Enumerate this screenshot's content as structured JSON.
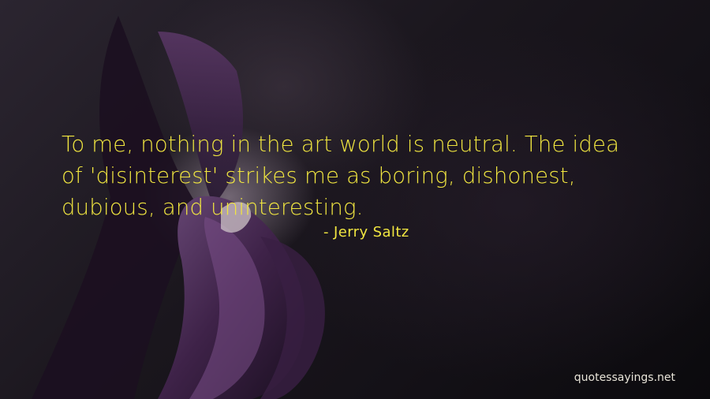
{
  "quote": {
    "text": "To me, nothing in the art world is neutral. The idea of 'disinterest' strikes me as boring, dishonest, dubious, and uninteresting.",
    "author": "- Jerry Saltz"
  },
  "watermark": {
    "text": "quotessayings.net"
  },
  "colors": {
    "quote_text": "#f1e640",
    "watermark_text": "#e8e4d8",
    "background": "#1a161d",
    "flower_petal": "#4a2a55"
  }
}
